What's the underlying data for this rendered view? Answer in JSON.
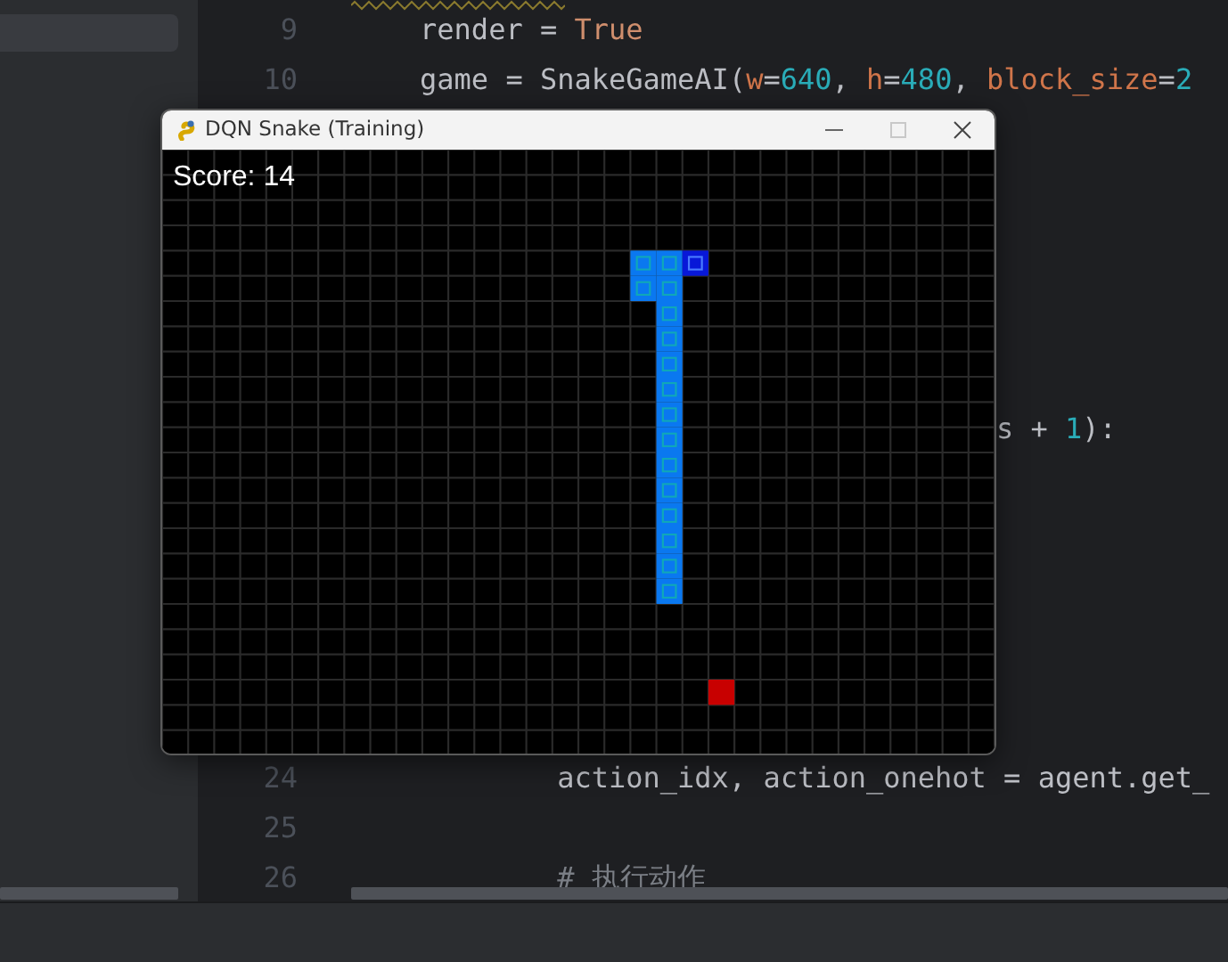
{
  "editor": {
    "lines": [
      {
        "number": "9",
        "tokens": [
          {
            "kind": "plain",
            "text": "    render = "
          },
          {
            "kind": "keyword",
            "text": "True"
          }
        ]
      },
      {
        "number": "10",
        "tokens": [
          {
            "kind": "plain",
            "text": "    game = SnakeGameAI("
          },
          {
            "kind": "param",
            "text": "w"
          },
          {
            "kind": "plain",
            "text": "="
          },
          {
            "kind": "number",
            "text": "640"
          },
          {
            "kind": "plain",
            "text": ", "
          },
          {
            "kind": "param",
            "text": "h"
          },
          {
            "kind": "plain",
            "text": "="
          },
          {
            "kind": "number",
            "text": "480"
          },
          {
            "kind": "plain",
            "text": ", "
          },
          {
            "kind": "param",
            "text": "block_size"
          },
          {
            "kind": "plain",
            "text": "="
          },
          {
            "kind": "number",
            "text": "2"
          }
        ]
      },
      {
        "kind": "tail",
        "tokens": [
          {
            "kind": "plain",
            "text": "s + "
          },
          {
            "kind": "number",
            "text": "1"
          },
          {
            "kind": "plain",
            "text": "):"
          }
        ]
      },
      {
        "number": "24",
        "tokens": [
          {
            "kind": "plain",
            "text": "            action_idx, action_onehot = agent.get_"
          }
        ]
      },
      {
        "number": "25"
      },
      {
        "number": "26",
        "tokens": [
          {
            "kind": "comment",
            "text": "            # 执行动作"
          }
        ]
      }
    ]
  },
  "game_window": {
    "title": "DQN Snake (Training)",
    "score": "Score: 14"
  }
}
